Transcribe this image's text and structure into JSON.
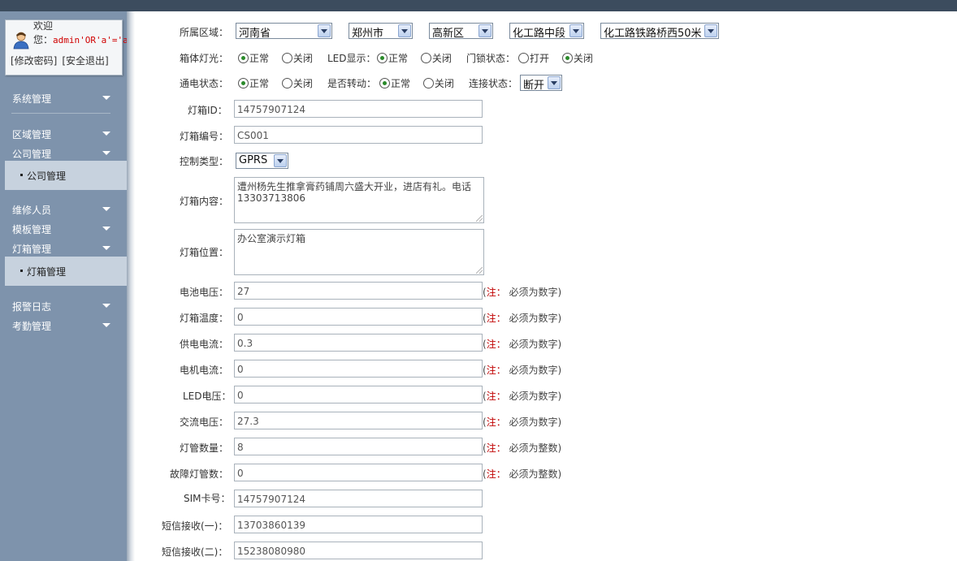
{
  "user": {
    "welcome": "欢迎",
    "prefix": "您：",
    "name": "admin'OR'a'='a",
    "change_password": "[修改密码]",
    "logout": "[安全退出]"
  },
  "menu": {
    "system": "系统管理",
    "region": "区域管理",
    "company": "公司管理",
    "company_sub": "公司管理",
    "repair": "维修人员",
    "template": "模板管理",
    "lightbox": "灯箱管理",
    "lightbox_sub": "灯箱管理",
    "alarm": "报警日志",
    "attendance": "考勤管理"
  },
  "form": {
    "region": {
      "label": "所属区域：",
      "province": "河南省",
      "city": "郑州市",
      "district": "高新区",
      "road": "化工路中段",
      "spot": "化工路铁路桥西50米"
    },
    "box_light": {
      "label": "箱体灯光：",
      "opt_on": "正常",
      "opt_off": "关闭",
      "selected": "正常"
    },
    "led_display": {
      "label": "LED显示：",
      "opt_on": "正常",
      "opt_off": "关闭",
      "selected": "正常"
    },
    "door_lock": {
      "label": "门锁状态：",
      "opt_open": "打开",
      "opt_close": "关闭",
      "selected": "关闭"
    },
    "power": {
      "label": "通电状态：",
      "opt_on": "正常",
      "opt_off": "关闭",
      "selected": "正常"
    },
    "rotate": {
      "label": "是否转动：",
      "opt_on": "正常",
      "opt_off": "关闭",
      "selected": "正常"
    },
    "connection": {
      "label": "连接状态：",
      "value": "断开"
    },
    "box_id": {
      "label": "灯箱ID：",
      "value": "14757907124"
    },
    "box_no": {
      "label": "灯箱编号：",
      "value": "CS001"
    },
    "control_type": {
      "label": "控制类型：",
      "value": "GPRS"
    },
    "content": {
      "label": "灯箱内容：",
      "value": "遭州杨先生推拿膏药铺周六盛大开业，进店有礼。电话13303713806"
    },
    "location": {
      "label": "灯箱位置：",
      "value": "办公室演示灯箱"
    },
    "battery_voltage": {
      "label": "电池电压：",
      "value": "27"
    },
    "temperature": {
      "label": "灯箱温度：",
      "value": "0"
    },
    "supply_current": {
      "label": "供电电流：",
      "value": "0.3"
    },
    "motor_current": {
      "label": "电机电流：",
      "value": "0"
    },
    "led_voltage": {
      "label": "LED电压：",
      "value": "0"
    },
    "ac_voltage": {
      "label": "交流电压：",
      "value": "27.3"
    },
    "tube_count": {
      "label": "灯管数量：",
      "value": "8"
    },
    "fault_tube_count": {
      "label": "故障灯管数：",
      "value": "0"
    },
    "sim": {
      "label": "SIM卡号：",
      "value": "14757907124"
    },
    "sms1": {
      "label": "短信接收(一)：",
      "value": "13703860139"
    },
    "sms2": {
      "label": "短信接收(二)：",
      "value": "15238080980"
    }
  },
  "notes": {
    "prefix": "(",
    "note_word": "注：",
    "numeric": " 必须为数字)",
    "integer": " 必须为整数)"
  },
  "colors": {
    "sidebar": "#7e93ac",
    "topbar": "#3c4c5e",
    "submenu": "#c7d2de",
    "note_red": "#c00000",
    "radio_selected": "#2a8a2a"
  }
}
